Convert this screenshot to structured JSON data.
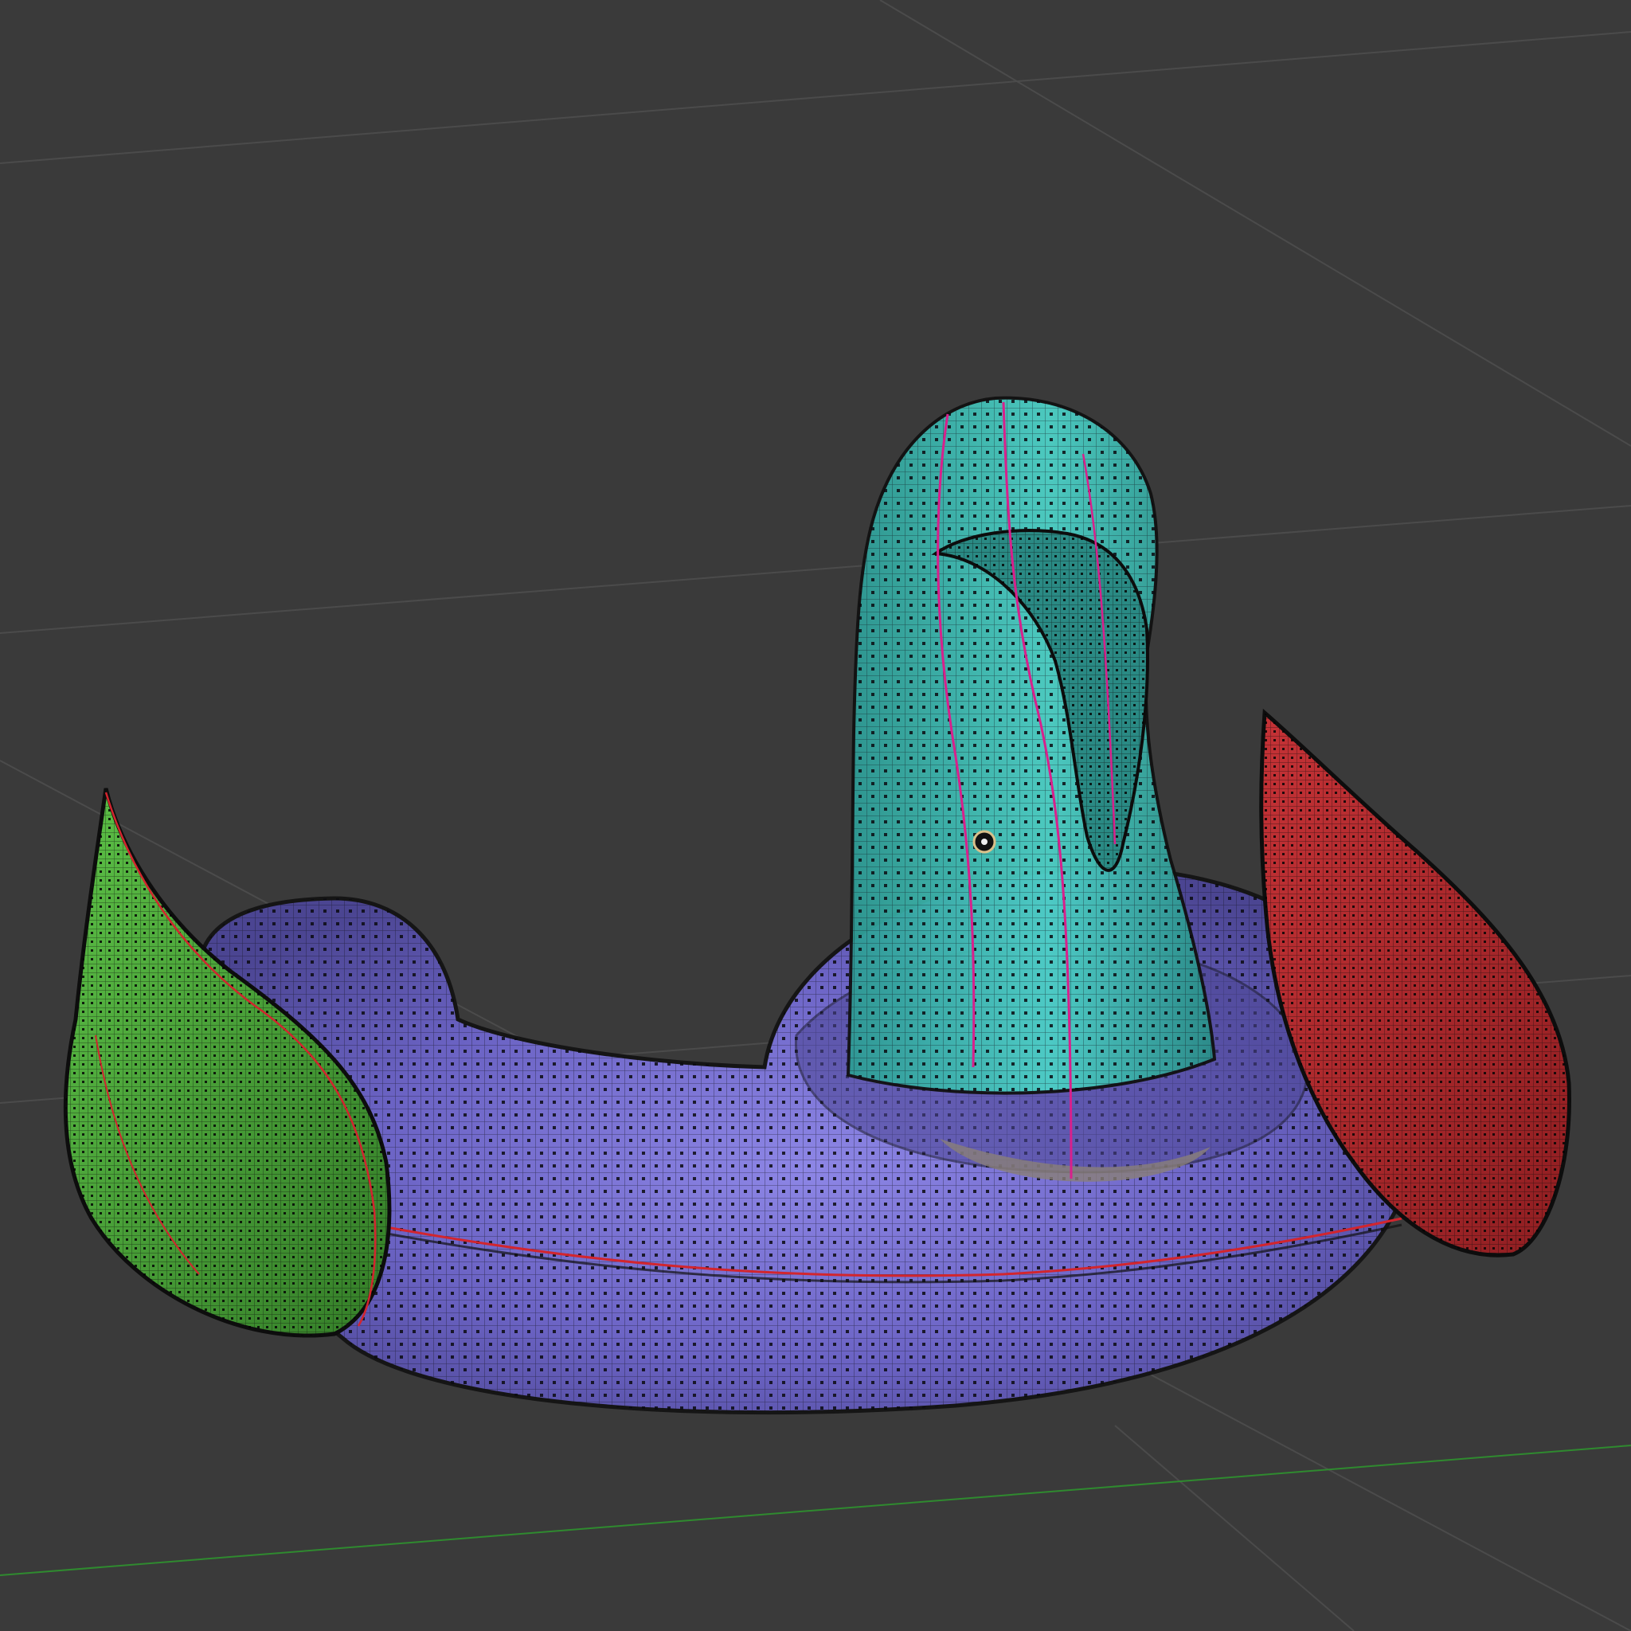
{
  "viewport": {
    "background_color": "#3a3a3a",
    "grid_line_color": "#4b4b4b",
    "x_axis_color": "#2f8a2f",
    "objects": [
      {
        "name": "ring-body",
        "color": "#6f67c8",
        "shape": "torus"
      },
      {
        "name": "neck-head",
        "color": "#40bcb2",
        "shape": "curved-neck"
      },
      {
        "name": "left-wing",
        "color": "#4aa53a",
        "shape": "teardrop"
      },
      {
        "name": "right-tail",
        "color": "#b52a2d",
        "shape": "teardrop"
      }
    ],
    "seam_color": "#d2252e",
    "neck_seam_color": "#d8208c",
    "wire_color": "#111111",
    "origin_marker_icon": "origin-dot-icon"
  }
}
